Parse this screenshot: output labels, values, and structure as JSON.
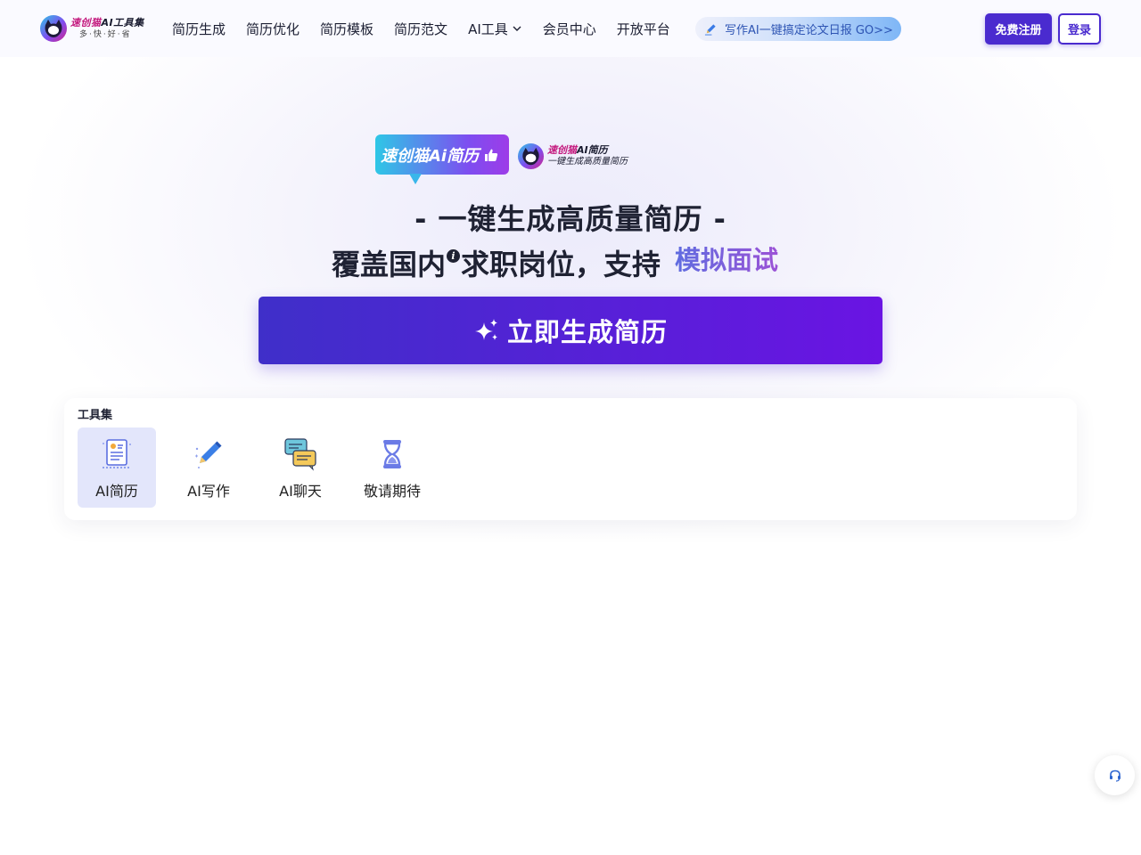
{
  "brand": {
    "logo_title_pink": "速创猫",
    "logo_title_rest": "AI工具集",
    "logo_sub": "多·快·好·省"
  },
  "nav": {
    "items": [
      {
        "label": "简历生成",
        "icon": ""
      },
      {
        "label": "简历优化",
        "icon": ""
      },
      {
        "label": "简历模板",
        "icon": ""
      },
      {
        "label": "简历范文",
        "icon": ""
      },
      {
        "label": "AI工具",
        "icon": "chevron-down-icon"
      },
      {
        "label": "会员中心",
        "icon": ""
      },
      {
        "label": "开放平台",
        "icon": ""
      }
    ],
    "promo": {
      "text": "写作AI一键搞定论文日报 GO>>",
      "icon": "pencil-icon"
    },
    "register_label": "免费注册",
    "login_label": "登录"
  },
  "hero": {
    "badge_text": "速创猫Ai简历",
    "badge_icon": "thumbs-up-icon",
    "badge_logo_title_pink": "速创猫",
    "badge_logo_title_rest": "AI简历",
    "badge_logo_sub": "一键生成高质量简历",
    "headline": "- 一键生成高质量简历 -",
    "subline_prefix": "覆盖国内",
    "subline_suffix": "求职岗位，支持",
    "info_glyph": "i",
    "rotating_feature": "模拟面试",
    "cta_label": "立即生成简历",
    "cta_icon": "sparkles-icon"
  },
  "tools": {
    "title": "工具集",
    "items": [
      {
        "label": "AI简历",
        "icon": "resume-document-icon",
        "active": true
      },
      {
        "label": "AI写作",
        "icon": "pen-writing-icon",
        "active": false
      },
      {
        "label": "AI聊天",
        "icon": "chat-bubbles-icon",
        "active": false
      },
      {
        "label": "敬请期待",
        "icon": "hourglass-icon",
        "active": false
      }
    ]
  },
  "support": {
    "icon": "headset-icon"
  },
  "colors": {
    "accent": "#4a2bcf",
    "cta_start": "#3f2fc9",
    "cta_end": "#6a14e3",
    "logo_pink": "#c3187d",
    "active_tool_bg": "#e3e6fb"
  }
}
